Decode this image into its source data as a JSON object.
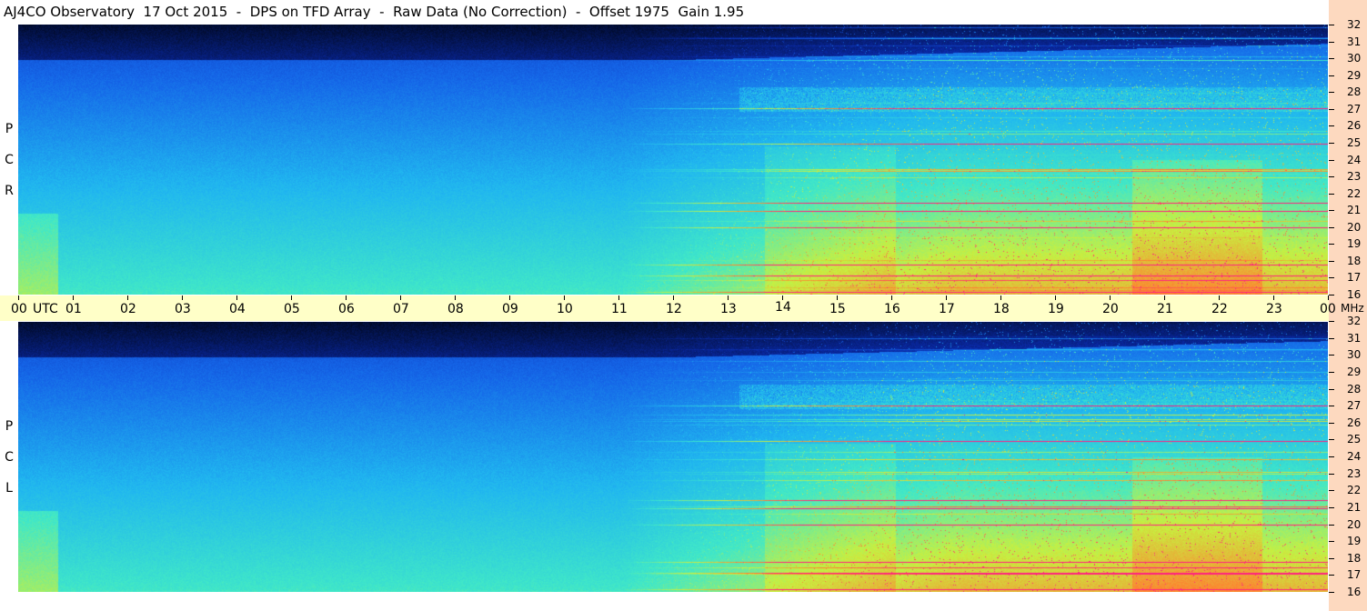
{
  "title": "AJ4CO Observatory  17 Oct 2015  -  DPS on TFD Array  -  Raw Data (No Correction)  -  Offset 1975  Gain 1.95",
  "panels": {
    "rcp": {
      "label_letters": [
        "R",
        "C",
        "P"
      ]
    },
    "lcp": {
      "label_letters": [
        "L",
        "C",
        "P"
      ]
    }
  },
  "time_axis": {
    "labels": [
      "00",
      "01",
      "02",
      "03",
      "04",
      "05",
      "06",
      "07",
      "08",
      "09",
      "10",
      "11",
      "12",
      "13",
      "14",
      "15",
      "16",
      "17",
      "18",
      "19",
      "20",
      "21",
      "22",
      "23",
      "00"
    ],
    "unit": "UTC"
  },
  "freq_axis": {
    "labels": [
      "32",
      "31",
      "30",
      "29",
      "28",
      "27",
      "26",
      "25",
      "24",
      "23",
      "22",
      "21",
      "20",
      "19",
      "18",
      "17",
      "16"
    ],
    "unit": "MHz"
  },
  "chart_data": {
    "type": "heatmap",
    "title": "AJ4CO Observatory  17 Oct 2015  -  DPS on TFD Array  -  Raw Data (No Correction)  -  Offset 1975  Gain 1.95",
    "x_axis": {
      "unit": "UTC",
      "range": [
        0,
        24
      ],
      "ticks": [
        "00",
        "01",
        "02",
        "03",
        "04",
        "05",
        "06",
        "07",
        "08",
        "09",
        "10",
        "11",
        "12",
        "13",
        "14",
        "15",
        "16",
        "17",
        "18",
        "19",
        "20",
        "21",
        "22",
        "23",
        "00"
      ]
    },
    "y_axis": {
      "unit": "MHz",
      "range": [
        16,
        32
      ],
      "ticks": [
        32,
        31,
        30,
        29,
        28,
        27,
        26,
        25,
        24,
        23,
        22,
        21,
        20,
        19,
        18,
        17,
        16
      ]
    },
    "panels": [
      "RCP",
      "LCP"
    ],
    "colormap": [
      "#000820",
      "#0a2aa8",
      "#1565e8",
      "#20b6f0",
      "#40e8c8",
      "#c8f040",
      "#ff8030",
      "#ff2080"
    ]
  }
}
